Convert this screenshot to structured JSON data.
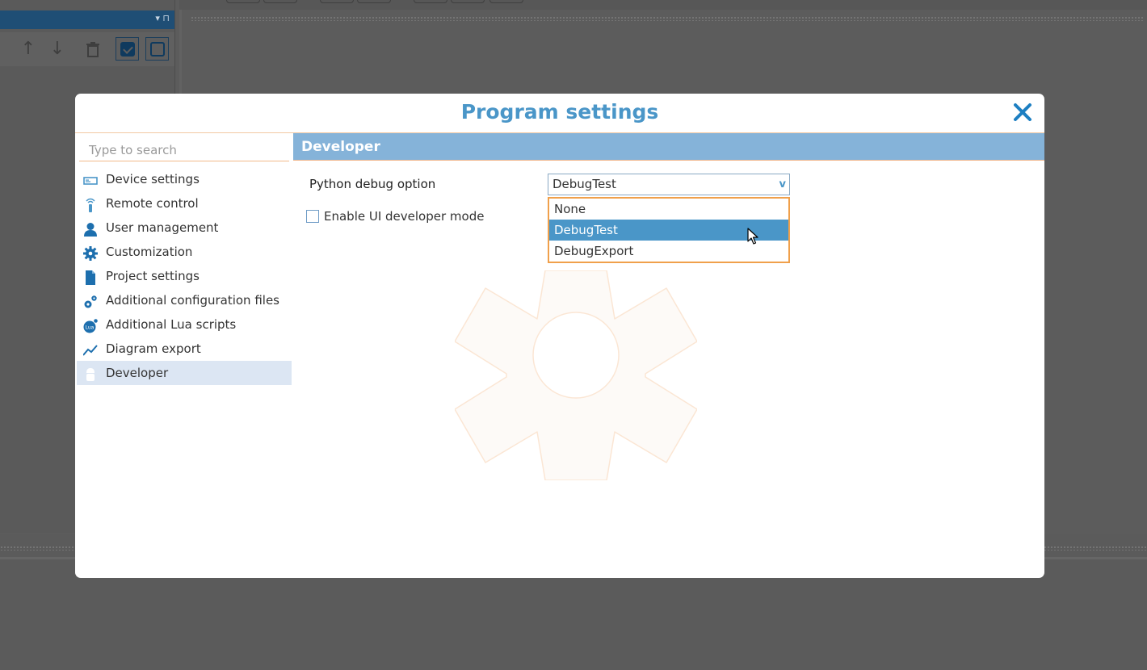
{
  "dialog": {
    "title": "Program settings"
  },
  "search": {
    "placeholder": "Type to search"
  },
  "sidebar": {
    "items": [
      {
        "label": "Device settings",
        "icon": "device-icon"
      },
      {
        "label": "Remote control",
        "icon": "remote-icon"
      },
      {
        "label": "User management",
        "icon": "user-icon"
      },
      {
        "label": "Customization",
        "icon": "gear-icon"
      },
      {
        "label": "Project settings",
        "icon": "document-icon"
      },
      {
        "label": "Additional configuration files",
        "icon": "gears-icon"
      },
      {
        "label": "Additional Lua scripts",
        "icon": "lua-icon"
      },
      {
        "label": "Diagram export",
        "icon": "chart-line-icon"
      },
      {
        "label": "Developer",
        "icon": "android-icon",
        "active": true
      }
    ]
  },
  "content": {
    "section_title": "Developer",
    "python_debug": {
      "label": "Python debug option",
      "value": "DebugTest",
      "options": [
        "None",
        "DebugTest",
        "DebugExport"
      ],
      "highlighted": "DebugTest"
    },
    "ui_dev_mode": {
      "label": "Enable UI developer mode",
      "checked": false
    }
  },
  "colors": {
    "accent": "#4a96c8",
    "section_header": "#85b3d9",
    "orange_border": "#f0a04b",
    "active_nav": "#dce6f3"
  }
}
